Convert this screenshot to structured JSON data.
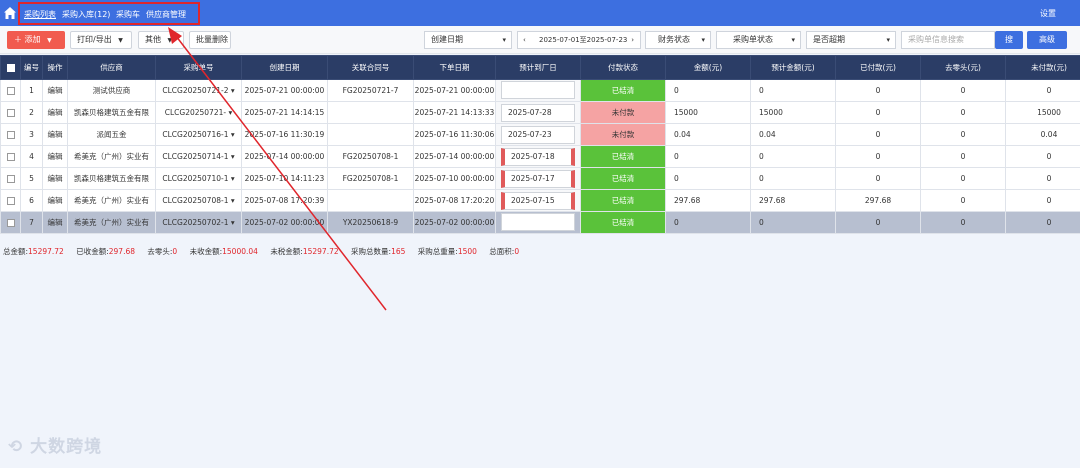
{
  "nav": {
    "items": [
      "采购列表",
      "采购入库(12)",
      "采购车",
      "供应商管理"
    ],
    "settings": "设置"
  },
  "toolbar": {
    "add": "添加",
    "print_export": "打印/导出",
    "other": "其他",
    "batch_delete": "批量删除",
    "date_type": "创建日期",
    "date_range": "2025-07-01至2025-07-23",
    "finance_status": "财务状态",
    "purchase_status": "采购单状态",
    "overdue": "是否超期",
    "search_placeholder": "采购单信息搜索",
    "search": "搜",
    "advanced": "高级"
  },
  "table": {
    "headers": [
      "编号",
      "操作",
      "供应商",
      "采购单号",
      "创建日期",
      "关联合同号",
      "下单日期",
      "预计到厂日",
      "付款状态",
      "金额(元)",
      "预计金额(元)",
      "已付款(元)",
      "去零头(元)",
      "未付款(元)"
    ],
    "rows": [
      {
        "no": "1",
        "op": "编辑",
        "supplier": "测试供应商",
        "order": "CLCG20250721-2",
        "created": "2025-07-21 00:00:00",
        "contract": "FG20250721-7",
        "ordered": "2025-07-21 00:00:00",
        "eta": "",
        "pay": "已结清",
        "amount": "0",
        "est": "0",
        "paid": "0",
        "round": "0",
        "unpaid": "0"
      },
      {
        "no": "2",
        "op": "编辑",
        "supplier": "凯森贝格建筑五金有限",
        "order": "CLCG20250721-",
        "created": "2025-07-21 14:14:15",
        "contract": "",
        "ordered": "2025-07-21 14:13:33",
        "eta": "2025-07-28",
        "pay": "未付款",
        "amount": "15000",
        "est": "15000",
        "paid": "0",
        "round": "0",
        "unpaid": "15000"
      },
      {
        "no": "3",
        "op": "编辑",
        "supplier": "派闻五金",
        "order": "CLCG20250716-1",
        "created": "2025-07-16 11:30:19",
        "contract": "",
        "ordered": "2025-07-16 11:30:06",
        "eta": "2025-07-23",
        "pay": "未付款",
        "amount": "0.04",
        "est": "0.04",
        "paid": "0",
        "round": "0",
        "unpaid": "0.04"
      },
      {
        "no": "4",
        "op": "编辑",
        "supplier": "希美克（广州）实业有",
        "order": "CLCG20250714-1",
        "created": "2025-07-14 00:00:00",
        "contract": "FG20250708-1",
        "ordered": "2025-07-14 00:00:00",
        "eta": "2025-07-18",
        "pay": "已结清",
        "amount": "0",
        "est": "0",
        "paid": "0",
        "round": "0",
        "unpaid": "0"
      },
      {
        "no": "5",
        "op": "编辑",
        "supplier": "凯森贝格建筑五金有限",
        "order": "CLCG20250710-1",
        "created": "2025-07-10 14:11:23",
        "contract": "FG20250708-1",
        "ordered": "2025-07-10 00:00:00",
        "eta": "2025-07-17",
        "pay": "已结清",
        "amount": "0",
        "est": "0",
        "paid": "0",
        "round": "0",
        "unpaid": "0"
      },
      {
        "no": "6",
        "op": "编辑",
        "supplier": "希美克（广州）实业有",
        "order": "CLCG20250708-1",
        "created": "2025-07-08 17:20:39",
        "contract": "",
        "ordered": "2025-07-08 17:20:20",
        "eta": "2025-07-15",
        "pay": "已结清",
        "amount": "297.68",
        "est": "297.68",
        "paid": "297.68",
        "round": "0",
        "unpaid": "0"
      },
      {
        "no": "7",
        "op": "编辑",
        "supplier": "希美克（广州）实业有",
        "order": "CLCG20250702-1",
        "created": "2025-07-02 00:00:00",
        "contract": "YX20250618-9",
        "ordered": "2025-07-02 00:00:00",
        "eta": "",
        "pay": "已结清",
        "amount": "0",
        "est": "0",
        "paid": "0",
        "round": "0",
        "unpaid": "0"
      }
    ]
  },
  "summary": {
    "total_label": "总金额:",
    "total": "15297.72",
    "received_label": "已收金额:",
    "received": "297.68",
    "round_label": "去零头:",
    "round": "0",
    "unreceived_label": "未收金额:",
    "unreceived": "15000.04",
    "pretax_label": "未税金额:",
    "pretax": "15297.72",
    "qty_label": "采购总数量:",
    "qty": "165",
    "weight_label": "采购总重量:",
    "weight": "1500",
    "area_label": "总面积:",
    "area": "0"
  },
  "watermark": "大数跨境",
  "colors": {
    "primary": "#3d6fe0",
    "header": "#2b3d66",
    "paid": "#5ac23a",
    "unpaid": "#f5a3a3",
    "highlight": "#e0262c"
  }
}
